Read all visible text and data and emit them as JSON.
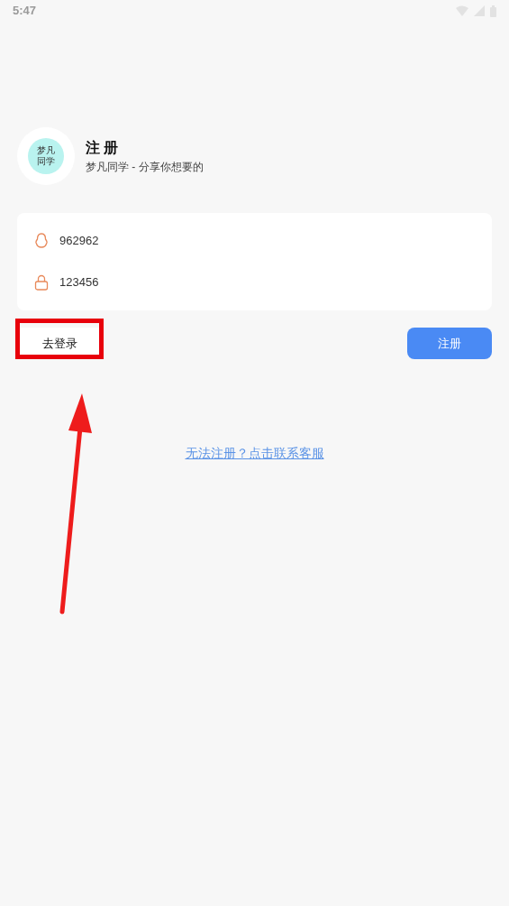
{
  "status_bar": {
    "time": "5:47"
  },
  "header": {
    "logo_lines": [
      "梦凡",
      "同学"
    ],
    "title": "注 册",
    "subtitle": "梦凡同学 - 分享你想要的"
  },
  "form": {
    "fields": [
      {
        "kind": "account",
        "value": "962962"
      },
      {
        "kind": "password",
        "value": "123456"
      }
    ]
  },
  "actions": {
    "login": "去登录",
    "register": "注册"
  },
  "help_link": "无法注册？点击联系客服"
}
